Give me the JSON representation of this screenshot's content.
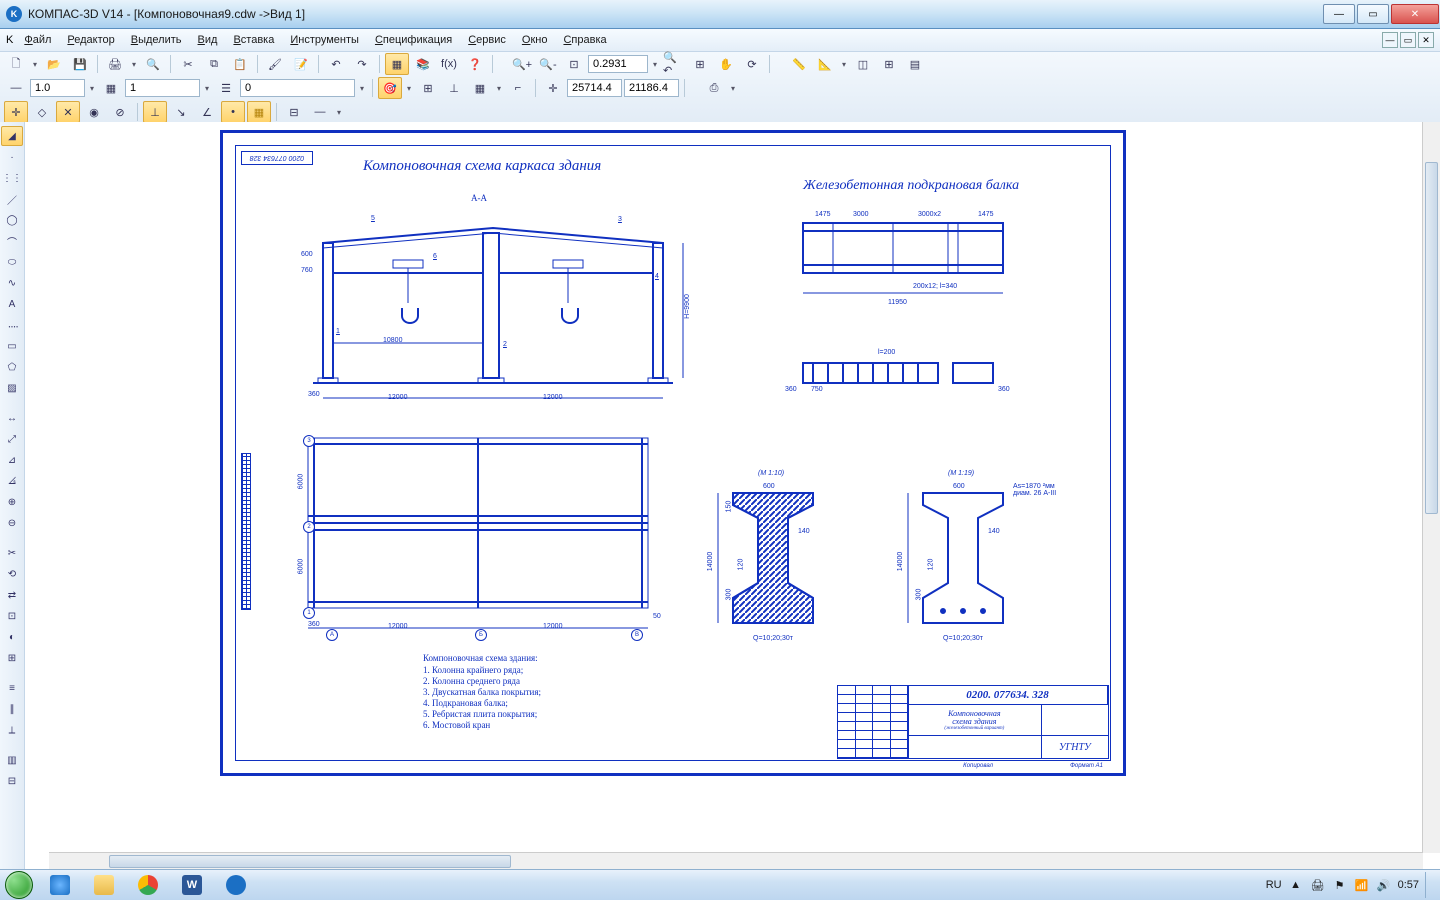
{
  "app": {
    "title": "КОМПАС-3D V14 - [Компоновочная9.cdw ->Вид 1]"
  },
  "menu": {
    "items": [
      "Файл",
      "Редактор",
      "Выделить",
      "Вид",
      "Вставка",
      "Инструменты",
      "Спецификация",
      "Сервис",
      "Окно",
      "Справка"
    ]
  },
  "toolbar": {
    "style_value": "1.0",
    "layer_value": "1",
    "step_value": "0",
    "zoom_value": "0.2931",
    "coord_x": "25714.4",
    "coord_y": "21186.4"
  },
  "drawing": {
    "title_left": "Компоновочная схема каркаса здания",
    "title_right": "Железобетонная подкрановая балка",
    "section_label": "А-А",
    "doc_number_tag": "0200 077634 328",
    "dims": {
      "span": "10800",
      "bay1": "12000",
      "bay2": "12000",
      "h": "H=9900",
      "d600": "600",
      "d760": "760",
      "d360": "360",
      "d1475a": "1475",
      "d3000": "3000",
      "d3000x2": "3000х2",
      "d1475b": "1475",
      "d11950": "11950",
      "d200x12": "200х12; l=340",
      "l200": "l=200",
      "d750": "750",
      "d6000a": "6000",
      "d6000b": "6000",
      "d50": "50",
      "scale10": "(М 1:10)",
      "scale19": "(М 1:19)",
      "w600a": "600",
      "w600b": "600",
      "w140a": "140",
      "w140b": "140",
      "h1400a": "14000",
      "h1400b": "14000",
      "h300a": "300",
      "h300b": "300",
      "h120a": "120",
      "h120b": "120",
      "h150": "150",
      "q_a": "Q=10;20;30т",
      "q_b": "Q=10;20;30т",
      "rebar": "As=1870 ²мм\nдиам. 26 А-III",
      "d360b": "360",
      "d360c": "360",
      "d360d": "360"
    },
    "legend_title": "Компоновочная схема здания:",
    "legend": [
      "1. Колонна крайнего ряда;",
      "2. Колонна среднего ряда",
      "3. Двускатная балка покрытия;",
      "4. Подкрановая балка;",
      "5. Ребристая плита покрытия;",
      "6. Мостовой кран"
    ],
    "callouts": {
      "c1": "1",
      "c2": "2",
      "c3": "3",
      "c4": "4",
      "c5": "5",
      "c6": "6"
    },
    "axis": {
      "a": "А",
      "b": "Б",
      "v": "В",
      "n1": "1",
      "n2": "2",
      "n3": "3"
    },
    "stamp": {
      "number": "0200. 077634. 328",
      "line1": "Компоновочная",
      "line2": "схема здания",
      "line3": "(железобетонный вариант)",
      "org": "УГНТУ",
      "format": "Формат А1",
      "copied": "Копировал"
    }
  },
  "taskbar": {
    "lang": "RU",
    "time": "0:57"
  }
}
